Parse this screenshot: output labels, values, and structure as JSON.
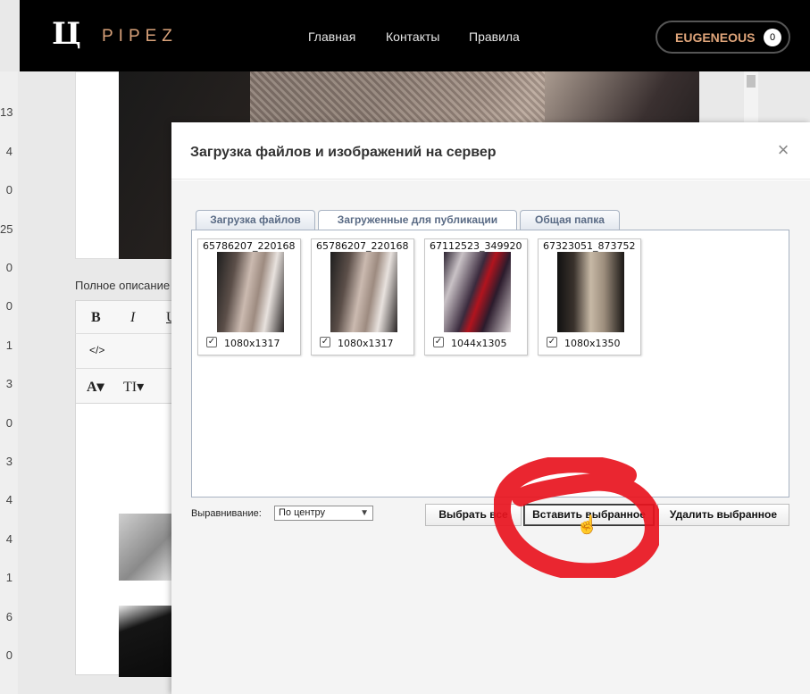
{
  "gutter": [
    "13",
    "4",
    "0",
    "25",
    "0",
    "0",
    "1",
    "3",
    "0",
    "3",
    "4",
    "4",
    "1",
    "6",
    "0"
  ],
  "header": {
    "logo_mark": "Ц",
    "logo_text": "PIPEZ",
    "nav": [
      "Главная",
      "Контакты",
      "Правила"
    ],
    "user_name": "EUGENEOUS",
    "user_badge": "0"
  },
  "page": {
    "full_description_label": "Полное описание",
    "editor_buttons": {
      "bold": "B",
      "italic": "I",
      "underline": "U",
      "code": "</>",
      "font_color": "A▾",
      "font_size": "TI▾"
    }
  },
  "modal": {
    "title": "Загрузка файлов и изображений на сервер",
    "close_glyph": "×",
    "tabs": [
      {
        "label": "Загрузка файлов",
        "active": false
      },
      {
        "label": "Загруженные для публикации",
        "active": true
      },
      {
        "label": "Общая папка",
        "active": false
      }
    ],
    "files": [
      {
        "name": "65786207_220168",
        "size": "1080x1317",
        "checked": true
      },
      {
        "name": "65786207_220168",
        "size": "1080x1317",
        "checked": true
      },
      {
        "name": "67112523_349920",
        "size": "1044x1305",
        "checked": true
      },
      {
        "name": "67323051_873752",
        "size": "1080x1350",
        "checked": true
      }
    ],
    "check_glyph": "✓",
    "align_label": "Выравнивание:",
    "align_value": "По центру",
    "buttons": {
      "select_all": "Выбрать все",
      "insert_selected": "Вставить выбранное",
      "delete_selected": "Удалить выбранное"
    }
  },
  "colors": {
    "annotation_red": "#e8141e",
    "brand_accent": "#d9a27a",
    "tab_text": "#5a6b85"
  }
}
